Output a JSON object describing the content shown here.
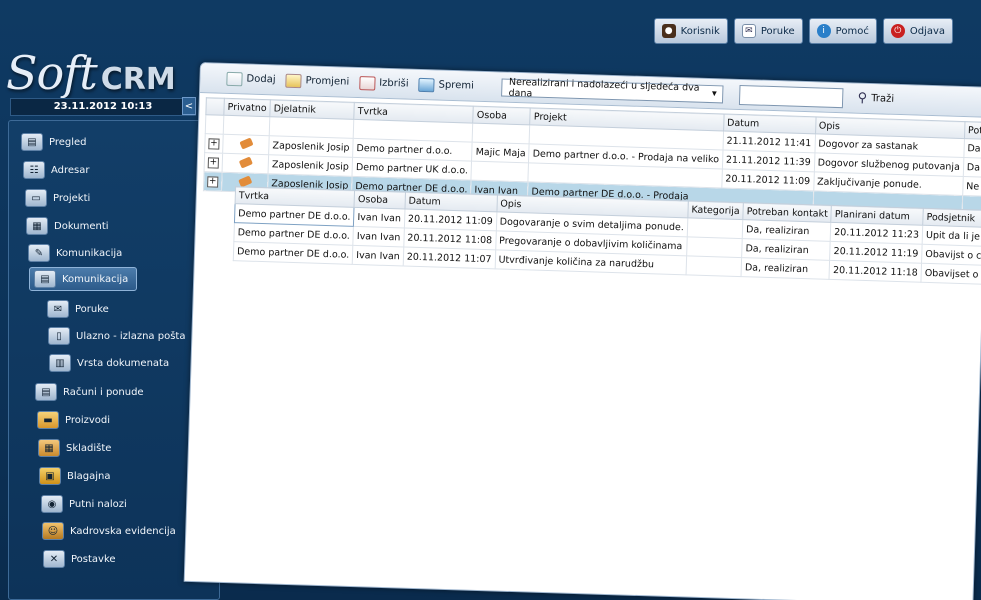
{
  "topbar": {
    "user_label": "Korisnik",
    "messages_label": "Poruke",
    "help_label": "Pomoć",
    "logout_label": "Odjava"
  },
  "brand": {
    "soft": "Soft",
    "crm": "CRM"
  },
  "datetime": "23.11.2012 10:13",
  "collapse_glyph": "<",
  "sidebar": {
    "items": [
      {
        "label": "Pregled",
        "icon": "overview-icon"
      },
      {
        "label": "Adresar",
        "icon": "address-book-icon"
      },
      {
        "label": "Projekti",
        "icon": "projects-icon"
      },
      {
        "label": "Dokumenti",
        "icon": "documents-icon"
      },
      {
        "label": "Komunikacija",
        "icon": "communication-icon"
      },
      {
        "label": "Komunikacija",
        "icon": "communication-sub-icon"
      },
      {
        "label": "Poruke",
        "icon": "envelope-icon"
      },
      {
        "label": "Ulazno - izlazna pošta",
        "icon": "mail-io-icon"
      },
      {
        "label": "Vrsta dokumenata",
        "icon": "document-type-icon"
      },
      {
        "label": "Računi i ponude",
        "icon": "invoice-icon"
      },
      {
        "label": "Proizvodi",
        "icon": "products-icon"
      },
      {
        "label": "Skladište",
        "icon": "warehouse-icon"
      },
      {
        "label": "Blagajna",
        "icon": "cash-register-icon"
      },
      {
        "label": "Putni nalozi",
        "icon": "travel-order-icon"
      },
      {
        "label": "Kadrovska evidencija",
        "icon": "hr-records-icon"
      },
      {
        "label": "Postavke",
        "icon": "settings-icon"
      }
    ]
  },
  "toolbar": {
    "add_label": "Dodaj",
    "edit_label": "Promjeni",
    "delete_label": "Izbriši",
    "save_label": "Spremi",
    "filter_selected": "Nerealizirani i nadolazeći u sljedeća dva dana",
    "search_value": "",
    "search_label": "Traži"
  },
  "grid": {
    "columns": [
      "Privatno",
      "Djelatnik",
      "Tvrtka",
      "Osoba",
      "Projekt",
      "Datum",
      "Opis",
      "Potreban odg"
    ],
    "rows": [
      {
        "expander": "",
        "djelatnik": "",
        "tvrtka": "",
        "osoba": "",
        "projekt": "",
        "datum": "21.11.2012 11:41",
        "opis": "Dogovor za sastanak",
        "potreban": "Da"
      },
      {
        "expander": "+",
        "djelatnik": "Zaposlenik Josip",
        "tvrtka": "Demo partner d.o.o.",
        "osoba": "Majic Maja",
        "projekt": "Demo partner d.o.o. - Prodaja na veliko",
        "datum": "21.11.2012 11:39",
        "opis": "Dogovor službenog putovanja",
        "potreban": "Da"
      },
      {
        "expander": "+",
        "djelatnik": "Zaposlenik Josip",
        "tvrtka": "Demo partner UK d.o.o.",
        "osoba": "",
        "projekt": "",
        "datum": "20.11.2012 11:09",
        "opis": "Zaključivanje ponude.",
        "potreban": "Ne"
      },
      {
        "expander": "+",
        "djelatnik": "Zaposlenik Josip",
        "tvrtka": "Demo partner DE d.o.o.",
        "osoba": "Ivan Ivan",
        "projekt": "Demo partner DE d.o.o. - Prodaja",
        "datum": "",
        "opis": "",
        "potreban": ""
      }
    ]
  },
  "subgrid": {
    "columns": [
      "Tvrtka",
      "Osoba",
      "Datum",
      "Opis",
      "Kategorija",
      "Potreban kontakt",
      "Planirani datum",
      "Podsjetnik"
    ],
    "rows": [
      {
        "tvrtka": "Demo partner DE d.o.o.",
        "osoba": "Ivan Ivan",
        "datum": "20.11.2012 11:09",
        "opis": "Dogovaranje o svim detaljima ponude.",
        "kategorija": "",
        "potreban": "Da, realiziran",
        "planirani": "20.11.2012 11:23",
        "podsjetnik": "Upit da li je ponude p"
      },
      {
        "tvrtka": "Demo partner DE d.o.o.",
        "osoba": "Ivan Ivan",
        "datum": "20.11.2012 11:08",
        "opis": "Pregovaranje o dobavljivim količinama",
        "kategorija": "",
        "potreban": "Da, realiziran",
        "planirani": "20.11.2012 11:19",
        "podsjetnik": "Obavijst o cijenama i"
      },
      {
        "tvrtka": "Demo partner DE d.o.o.",
        "osoba": "Ivan Ivan",
        "datum": "20.11.2012 11:07",
        "opis": "Utvrđivanje količina za narudžbu",
        "kategorija": "",
        "potreban": "Da, realiziran",
        "planirani": "20.11.2012 11:18",
        "podsjetnik": "Obavijset o dobavljivi"
      }
    ]
  }
}
